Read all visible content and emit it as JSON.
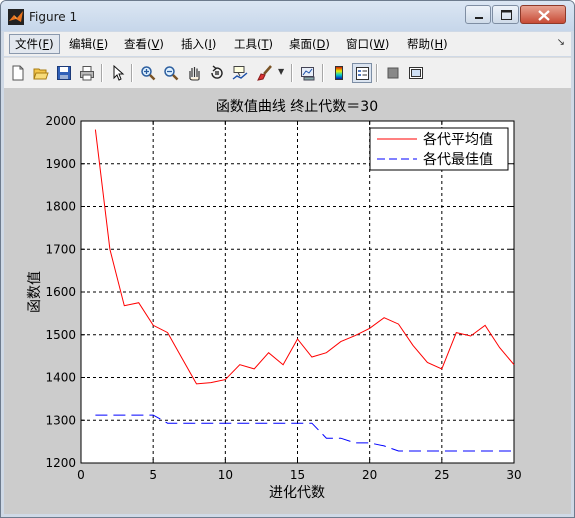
{
  "window": {
    "title": "Figure 1",
    "controls": [
      "minimize",
      "maximize",
      "close"
    ]
  },
  "menubar": {
    "items": [
      {
        "label": "文件(",
        "key": "F",
        "tail": ")"
      },
      {
        "label": "编辑(",
        "key": "E",
        "tail": ")"
      },
      {
        "label": "查看(",
        "key": "V",
        "tail": ")"
      },
      {
        "label": "插入(",
        "key": "I",
        "tail": ")"
      },
      {
        "label": "工具(",
        "key": "T",
        "tail": ")"
      },
      {
        "label": "桌面(",
        "key": "D",
        "tail": ")"
      },
      {
        "label": "窗口(",
        "key": "W",
        "tail": ")"
      },
      {
        "label": "帮助(",
        "key": "H",
        "tail": ")"
      }
    ],
    "overflow_arrow": "↘"
  },
  "toolbar": {
    "icons": [
      "new-figure-icon",
      "open-file-icon",
      "save-icon",
      "print-icon",
      "pointer-icon",
      "zoom-in-icon",
      "zoom-out-icon",
      "pan-icon",
      "rotate-icon",
      "data-cursor-icon",
      "brush-icon",
      "link-plot-icon",
      "colorbar-icon",
      "legend-icon",
      "hide-plot-tools-icon",
      "show-plot-tools-icon"
    ]
  },
  "colors": {
    "avg_series": "#ff0000",
    "best_series": "#0000ff",
    "figure_bg": "#cccccc",
    "axes_bg": "#ffffff"
  },
  "chart_data": {
    "type": "line",
    "title": "函数值曲线  终止代数＝30",
    "xlabel": "进化代数",
    "ylabel": "函数值",
    "xlim": [
      0,
      30
    ],
    "ylim": [
      1200,
      2000
    ],
    "xticks": [
      0,
      5,
      10,
      15,
      20,
      25,
      30
    ],
    "yticks": [
      1200,
      1300,
      1400,
      1500,
      1600,
      1700,
      1800,
      1900,
      2000
    ],
    "grid": true,
    "legend_position": "top-right",
    "x": [
      1,
      2,
      3,
      4,
      5,
      6,
      7,
      8,
      9,
      10,
      11,
      12,
      13,
      14,
      15,
      16,
      17,
      18,
      19,
      20,
      21,
      22,
      23,
      24,
      25,
      26,
      27,
      28,
      29,
      30
    ],
    "series": [
      {
        "name": "各代平均值",
        "style": "solid",
        "color": "#ff0000",
        "values": [
          1980,
          1700,
          1568,
          1575,
          1522,
          1505,
          1445,
          1385,
          1388,
          1395,
          1430,
          1420,
          1458,
          1430,
          1490,
          1448,
          1458,
          1484,
          1498,
          1515,
          1540,
          1525,
          1475,
          1435,
          1420,
          1505,
          1497,
          1522,
          1470,
          1430
        ]
      },
      {
        "name": "各代最佳值",
        "style": "dashed",
        "color": "#0000ff",
        "values": [
          1312,
          1312,
          1312,
          1312,
          1312,
          1293,
          1293,
          1293,
          1293,
          1293,
          1293,
          1293,
          1293,
          1293,
          1293,
          1293,
          1258,
          1258,
          1247,
          1247,
          1240,
          1228,
          1228,
          1228,
          1228,
          1228,
          1228,
          1228,
          1228,
          1228
        ]
      }
    ]
  }
}
